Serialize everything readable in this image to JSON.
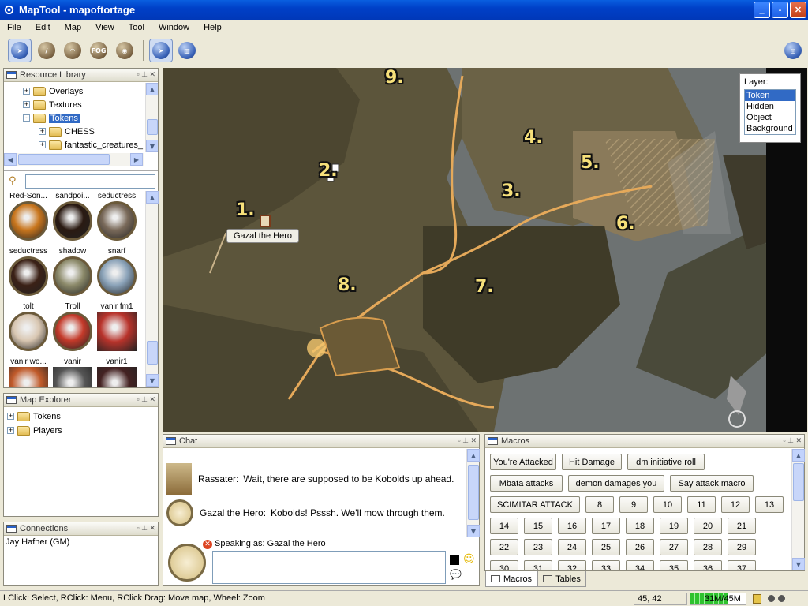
{
  "window": {
    "title": "MapTool - mapoftortage"
  },
  "menu": [
    "File",
    "Edit",
    "Map",
    "View",
    "Tool",
    "Window",
    "Help"
  ],
  "toolbar": {
    "tools": [
      "pointer-tool",
      "draw-tool",
      "template-tool",
      "FOG",
      "vision-tool",
      "select-tool",
      "measure-tool"
    ],
    "fog_label": "FOG"
  },
  "resources": {
    "title": "Resource Library",
    "tree": [
      {
        "label": "Overlays",
        "expander": "+"
      },
      {
        "label": "Textures",
        "expander": "+"
      },
      {
        "label": "Tokens",
        "expander": "-",
        "selected": true
      },
      {
        "label": "CHESS",
        "expander": "+"
      },
      {
        "label": "fantastic_creatures_",
        "expander": "+"
      }
    ],
    "search_value": "",
    "tokens": [
      {
        "label": "Red-Son...",
        "color": "#c9761d"
      },
      {
        "label": "sandpoi...",
        "color": "#2a1a12"
      },
      {
        "label": "seductress",
        "color": "#7a6a5a"
      },
      {
        "label": "seductress",
        "color": "#3b2116"
      },
      {
        "label": "shadow",
        "color": "#8c8a6a"
      },
      {
        "label": "snarf",
        "color": "#8aa2b8"
      },
      {
        "label": "tolt",
        "color": "#d9c7b2"
      },
      {
        "label": "Troll",
        "color": "#c43a2a"
      },
      {
        "label": "vanir fm1",
        "color": "#b8332b"
      },
      {
        "label": "vanir wo...",
        "color": "#c05a2a"
      },
      {
        "label": "vanir",
        "color": "#555"
      },
      {
        "label": "vanir1",
        "color": "#442222"
      }
    ]
  },
  "map_explorer": {
    "title": "Map Explorer",
    "items": [
      "Tokens",
      "Players"
    ]
  },
  "connections": {
    "title": "Connections",
    "items": [
      "Jay Hafner (GM)"
    ]
  },
  "map": {
    "labels": [
      "9.",
      "2.",
      "4.",
      "5.",
      "3.",
      "1.",
      "6.",
      "8.",
      "7."
    ],
    "tooltip": "Gazal the Hero",
    "layer_title": "Layer:",
    "layers": [
      "Token",
      "Hidden",
      "Object",
      "Background"
    ],
    "active_layer": "Token"
  },
  "chat": {
    "title": "Chat",
    "messages": [
      {
        "speaker": "Rassater:",
        "text": "Wait, there are supposed to be Kobolds up ahead."
      },
      {
        "speaker": "Gazal the Hero:",
        "text": "Kobolds! Psssh. We'll mow through them."
      }
    ],
    "speaking_as": "Speaking as: Gazal the Hero",
    "input_value": ""
  },
  "macros": {
    "title": "Macros",
    "rows": [
      [
        "You're Attacked",
        "Hit Damage",
        "dm initiative roll"
      ],
      [
        "Mbata attacks",
        "demon damages you",
        "Say attack macro"
      ],
      [
        "SCIMITAR ATTACK",
        "8",
        "9",
        "10",
        "11",
        "12",
        "13"
      ],
      [
        "14",
        "15",
        "16",
        "17",
        "18",
        "19",
        "20",
        "21"
      ],
      [
        "22",
        "23",
        "24",
        "25",
        "26",
        "27",
        "28",
        "29"
      ],
      [
        "30",
        "31",
        "32",
        "33",
        "34",
        "35",
        "36",
        "37"
      ]
    ],
    "tabs": [
      "Macros",
      "Tables"
    ],
    "active_tab": "Macros"
  },
  "status": {
    "hint": "LClick: Select, RClick: Menu, RClick Drag: Move map, Wheel: Zoom",
    "coords": "45, 42",
    "memory": "31M/45M",
    "memory_fraction": 0.69
  }
}
